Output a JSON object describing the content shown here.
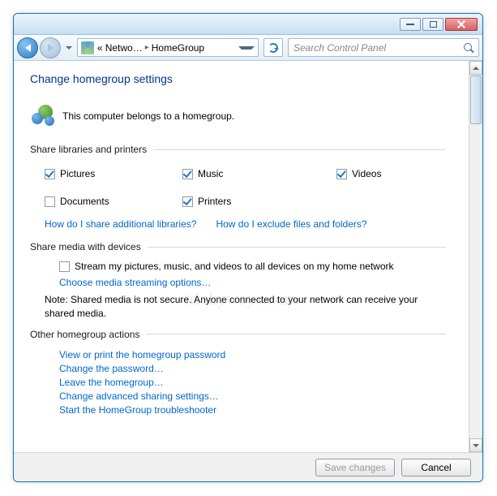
{
  "titlebar": {},
  "nav": {
    "breadcrumb_prefix": "«",
    "breadcrumb_item1": "Netwo…",
    "breadcrumb_item2": "HomeGroup",
    "search_placeholder": "Search Control Panel"
  },
  "heading": "Change homegroup settings",
  "belongs_text": "This computer belongs to a homegroup.",
  "section_share_label": "Share libraries and printers",
  "checkboxes": {
    "pictures": {
      "label": "Pictures",
      "checked": true
    },
    "music": {
      "label": "Music",
      "checked": true
    },
    "videos": {
      "label": "Videos",
      "checked": true
    },
    "documents": {
      "label": "Documents",
      "checked": false
    },
    "printers": {
      "label": "Printers",
      "checked": true
    }
  },
  "link_additional": "How do I share additional libraries?",
  "link_exclude": "How do I exclude files and folders?",
  "section_media_label": "Share media with devices",
  "stream_checkbox": {
    "label": "Stream my pictures, music, and videos to all devices on my home network",
    "checked": false
  },
  "link_media_options": "Choose media streaming options…",
  "note_text": "Note: Shared media is not secure. Anyone connected to your network can receive your shared media.",
  "section_actions_label": "Other homegroup actions",
  "actions": {
    "view_password": "View or print the homegroup password",
    "change_password": "Change the password…",
    "leave": "Leave the homegroup…",
    "advanced": "Change advanced sharing settings…",
    "troubleshoot": "Start the HomeGroup troubleshooter"
  },
  "footer": {
    "save": "Save changes",
    "cancel": "Cancel"
  },
  "watermark": "trickyways.com"
}
